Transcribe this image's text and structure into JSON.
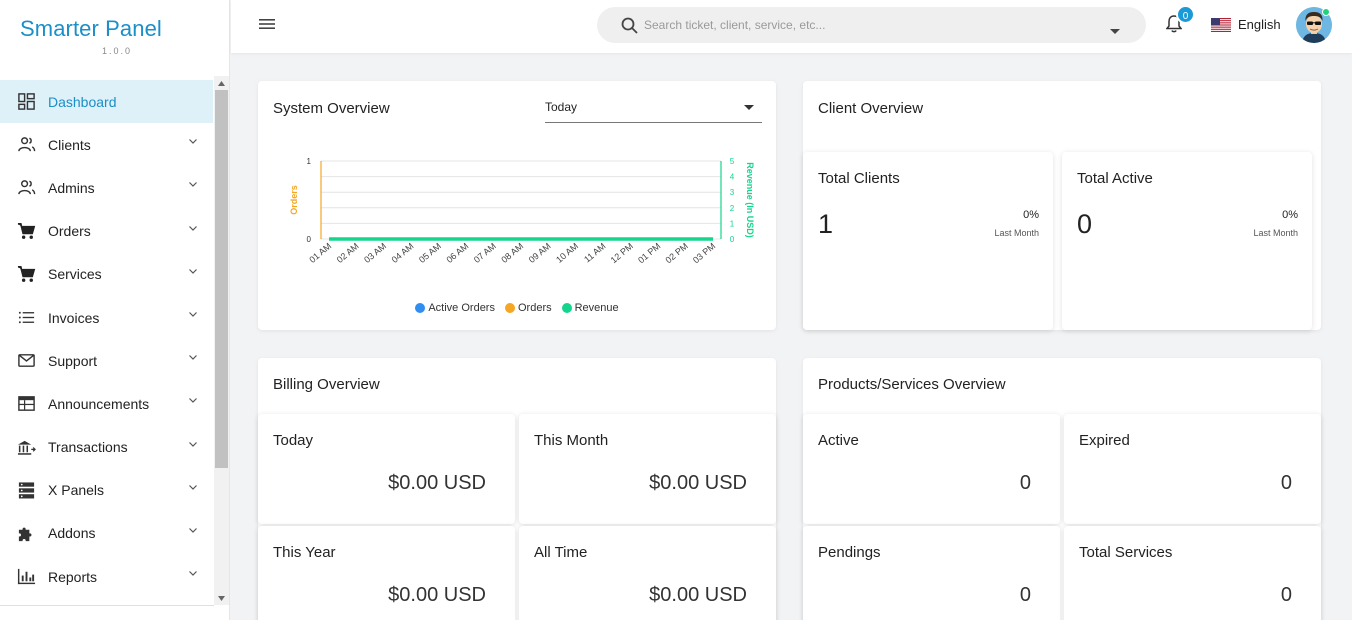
{
  "brand": {
    "name": "Smarter Panel",
    "version": "1.0.0"
  },
  "sidebar": {
    "items": [
      {
        "label": "Dashboard",
        "icon": "dashboard-icon",
        "active": true
      },
      {
        "label": "Clients",
        "icon": "users-icon"
      },
      {
        "label": "Admins",
        "icon": "admins-icon"
      },
      {
        "label": "Orders",
        "icon": "cart-icon"
      },
      {
        "label": "Services",
        "icon": "cart-icon"
      },
      {
        "label": "Invoices",
        "icon": "list-icon"
      },
      {
        "label": "Support",
        "icon": "mail-icon"
      },
      {
        "label": "Announcements",
        "icon": "table-icon"
      },
      {
        "label": "Transactions",
        "icon": "bank-icon"
      },
      {
        "label": "X Panels",
        "icon": "server-icon"
      },
      {
        "label": "Addons",
        "icon": "puzzle-icon"
      },
      {
        "label": "Reports",
        "icon": "bar-chart-icon"
      }
    ]
  },
  "header": {
    "search_placeholder": "Search ticket, client, service, etc...",
    "notification_count": "0",
    "language": "English"
  },
  "system_overview": {
    "title": "System Overview",
    "period": "Today"
  },
  "client_overview": {
    "title": "Client Overview",
    "total_clients": {
      "label": "Total Clients",
      "value": "1",
      "pct": "0%",
      "pct_label": "Last Month"
    },
    "total_active": {
      "label": "Total Active",
      "value": "0",
      "pct": "0%",
      "pct_label": "Last Month"
    }
  },
  "billing_overview": {
    "title": "Billing Overview",
    "today": {
      "label": "Today",
      "value": "$0.00 USD"
    },
    "this_month": {
      "label": "This Month",
      "value": "$0.00 USD"
    },
    "this_year": {
      "label": "This Year",
      "value": "$0.00 USD"
    },
    "all_time": {
      "label": "All Time",
      "value": "$0.00 USD"
    }
  },
  "products_overview": {
    "title": "Products/Services Overview",
    "active": {
      "label": "Active",
      "value": "0"
    },
    "expired": {
      "label": "Expired",
      "value": "0"
    },
    "pendings": {
      "label": "Pendings",
      "value": "0"
    },
    "total_services": {
      "label": "Total Services",
      "value": "0"
    }
  },
  "colors": {
    "accent": "#1a8fc8",
    "active_orders": "#2f8ef0",
    "orders": "#f5a623",
    "revenue": "#13d68c"
  },
  "chart_data": {
    "type": "line",
    "categories": [
      "01 AM",
      "02 AM",
      "03 AM",
      "04 AM",
      "05 AM",
      "06 AM",
      "07 AM",
      "08 AM",
      "09 AM",
      "10 AM",
      "11 AM",
      "12 PM",
      "01 PM",
      "02 PM",
      "03 PM"
    ],
    "series": [
      {
        "name": "Active Orders",
        "axis": "left",
        "values": [
          0,
          0,
          0,
          0,
          0,
          0,
          0,
          0,
          0,
          0,
          0,
          0,
          0,
          0,
          0
        ]
      },
      {
        "name": "Orders",
        "axis": "left",
        "values": [
          0,
          0,
          0,
          0,
          0,
          0,
          0,
          0,
          0,
          0,
          0,
          0,
          0,
          0,
          0
        ]
      },
      {
        "name": "Revenue",
        "axis": "right",
        "values": [
          0,
          0,
          0,
          0,
          0,
          0,
          0,
          0,
          0,
          0,
          0,
          0,
          0,
          0,
          0
        ]
      }
    ],
    "ylabel": "Orders",
    "ylabel_right": "Revenue (In USD)",
    "ylim": [
      0,
      1
    ],
    "ylim_right": [
      0,
      5
    ],
    "yticks": [
      0,
      1
    ],
    "yticks_right": [
      0,
      1,
      2,
      3,
      4,
      5
    ],
    "grid": true,
    "legend": "bottom"
  }
}
